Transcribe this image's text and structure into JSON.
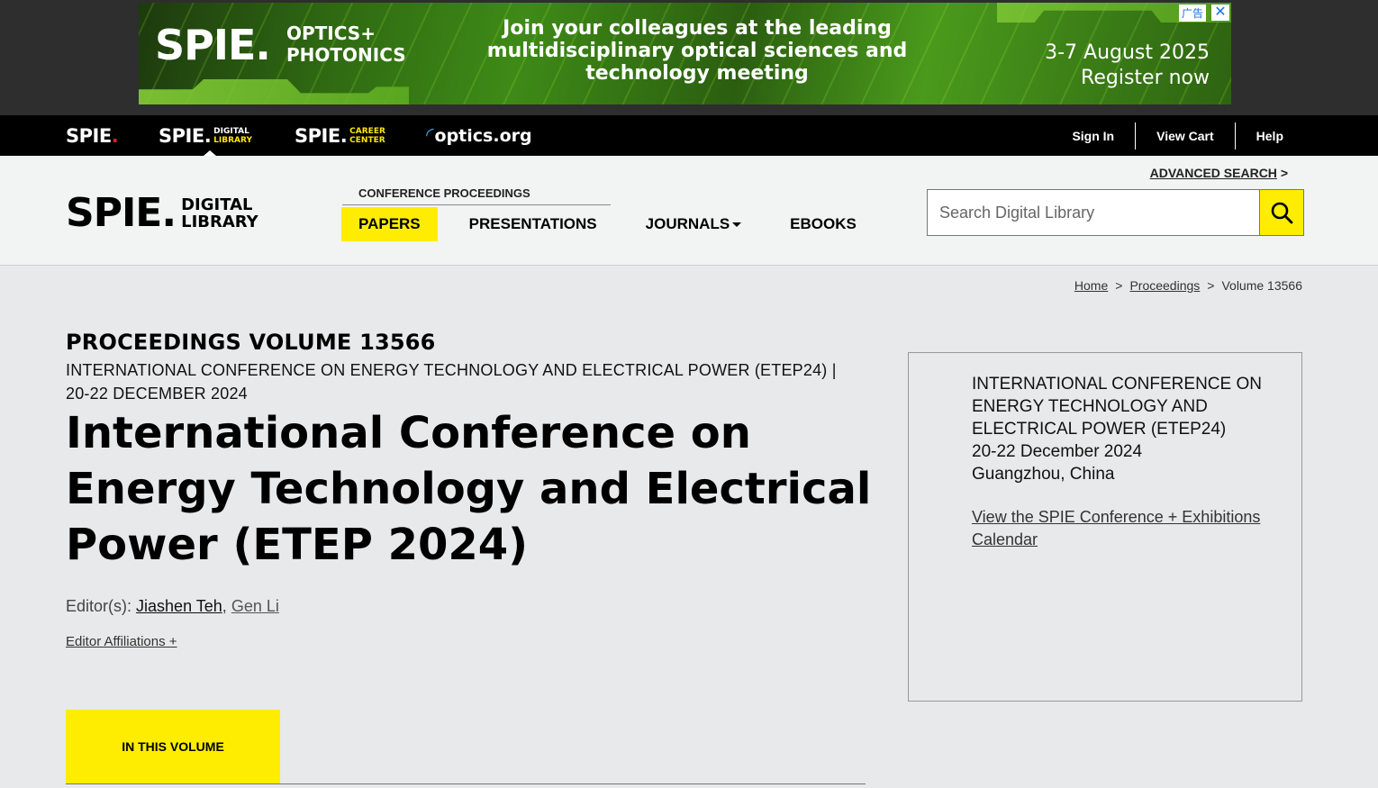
{
  "ad": {
    "logo": "SPIE.",
    "logo_sub_1": "OPTICS+",
    "logo_sub_2": "PHOTONICS",
    "message_1": "Join your colleagues at the leading",
    "message_2": "multidisciplinary optical sciences and",
    "message_3": "technology meeting",
    "date": "3-7 August 2025",
    "cta": "Register now",
    "badge": "广告",
    "close": "✕"
  },
  "topbar": {
    "brands": [
      {
        "word": "SPIE",
        "sub1": "",
        "sub2": ""
      },
      {
        "word": "SPIE",
        "sub1": "DIGITAL",
        "sub2": "LIBRARY"
      },
      {
        "word": "SPIE",
        "sub1": "CAREER",
        "sub2": "CENTER"
      },
      {
        "word": "optics.org"
      }
    ],
    "links": [
      "Sign In",
      "View Cart",
      "Help"
    ]
  },
  "header": {
    "logo_word": "SPIE.",
    "logo_sub_1": "DIGITAL",
    "logo_sub_2": "LIBRARY",
    "conf_label": "CONFERENCE PROCEEDINGS",
    "nav": [
      "PAPERS",
      "PRESENTATIONS",
      "JOURNALS",
      "EBOOKS"
    ],
    "advanced_search": "ADVANCED SEARCH",
    "advanced_arrow": ">",
    "search_placeholder": "Search Digital Library"
  },
  "breadcrumb": {
    "items": [
      "Home",
      "Proceedings",
      "Volume 13566"
    ],
    "sep": ">"
  },
  "main": {
    "volume_label": "PROCEEDINGS VOLUME 13566",
    "conf_sub": "INTERNATIONAL CONFERENCE ON ENERGY TECHNOLOGY AND ELECTRICAL POWER (ETEP24) | 20-22 DECEMBER 2024",
    "title": "International Conference on Energy Technology and Electrical Power (ETEP 2024)",
    "editors_label": "Editor(s):",
    "editors": [
      "Jiashen Teh",
      "Gen Li"
    ],
    "editor_sep": ",",
    "affiliations": "Editor Affiliations +",
    "tab": "IN THIS VOLUME"
  },
  "card": {
    "conf_name": "INTERNATIONAL CONFERENCE ON ENERGY TECHNOLOGY AND ELECTRICAL POWER (ETEP24)",
    "dates": "20-22 December 2024",
    "location": "Guangzhou, China",
    "link": "View the SPIE Conference + Exhibitions Calendar"
  },
  "colors": {
    "accent_yellow": "#ffed00",
    "topbar": "#000000",
    "header_bg": "#f2f3f3",
    "page_bg": "#e8e9ea"
  }
}
